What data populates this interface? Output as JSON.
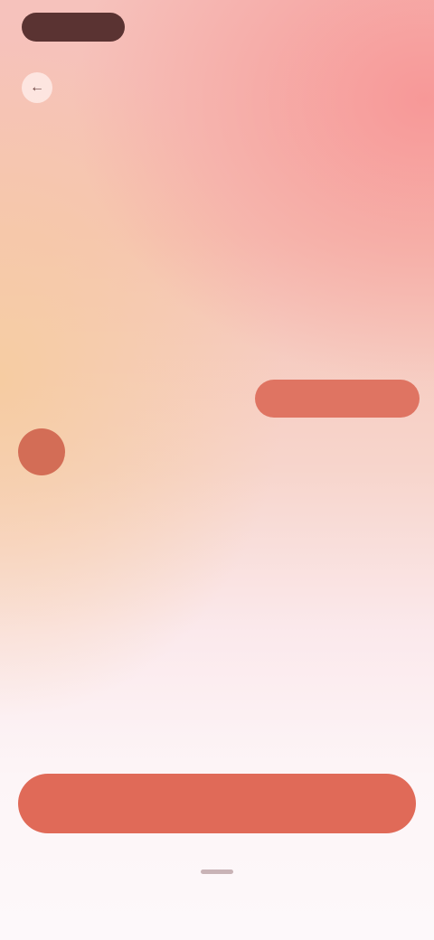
{
  "header": {
    "logo_text": "",
    "action_label": ""
  },
  "back": {
    "icon": "arrow-left-icon",
    "label": ""
  },
  "title": "",
  "weekdays": [
    "",
    "",
    "",
    "",
    "",
    "",
    ""
  ],
  "months": [
    {
      "label": "",
      "days": [
        "",
        "",
        "",
        "",
        "",
        "",
        "",
        "",
        "",
        "",
        "",
        "",
        "",
        "",
        "",
        "",
        "",
        "",
        "",
        "",
        "",
        "",
        "",
        "",
        "",
        "",
        "",
        ""
      ]
    },
    {
      "label": "",
      "days": [
        "",
        "",
        "",
        "",
        "",
        "",
        "",
        "",
        "",
        "",
        "",
        "",
        "",
        ""
      ]
    }
  ],
  "range_label": "",
  "helper_text": "",
  "primary_button_label": "",
  "colors": {
    "accent": "#e06a58",
    "selected": "#d36d56",
    "logo_bg": "#5a3332"
  }
}
